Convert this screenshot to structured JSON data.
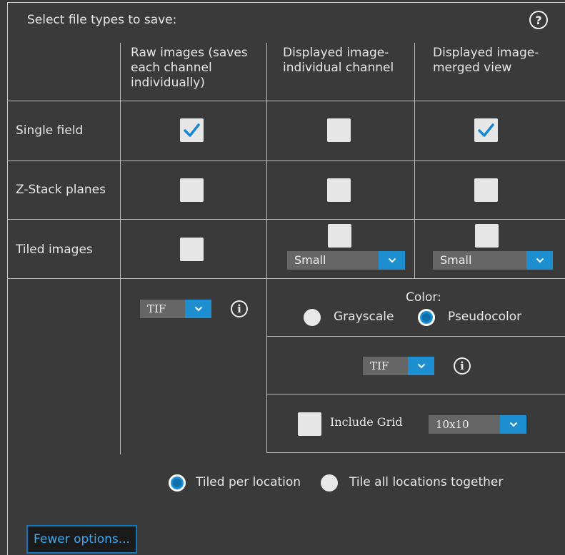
{
  "header": {
    "title": "Select file types to save:",
    "help_icon": "question-circle-icon",
    "help_glyph": "?"
  },
  "columns": [
    "Raw images (saves each channel individually)",
    "Displayed image-individual channel",
    "Displayed image-merged view"
  ],
  "rows": [
    {
      "label": "Single field",
      "checks": [
        true,
        false,
        true
      ]
    },
    {
      "label": "Z-Stack planes",
      "checks": [
        false,
        false,
        false
      ]
    },
    {
      "label": "Tiled images",
      "checks": [
        false,
        false,
        false
      ]
    }
  ],
  "tiled_sizes": {
    "individual_channel": "Small",
    "merged_view": "Small"
  },
  "raw_format": {
    "value": "TIF",
    "info_icon": "info-icon",
    "info_glyph": "i"
  },
  "color": {
    "label": "Color:",
    "options": [
      "Grayscale",
      "Pseudocolor"
    ],
    "selected": "Pseudocolor"
  },
  "displayed_format": {
    "value": "TIF",
    "info_icon": "info-icon",
    "info_glyph": "i"
  },
  "grid": {
    "label": "Include Grid",
    "checked": false,
    "size": "10x10"
  },
  "tiling": {
    "options": [
      "Tiled per location",
      "Tile all locations together"
    ],
    "selected": "Tiled per location"
  },
  "fewer_options_label": "Fewer options...",
  "colors": {
    "background": "#3a3a3a",
    "accent": "#1d8fd1",
    "grid_lines": "#bdbdbd"
  }
}
